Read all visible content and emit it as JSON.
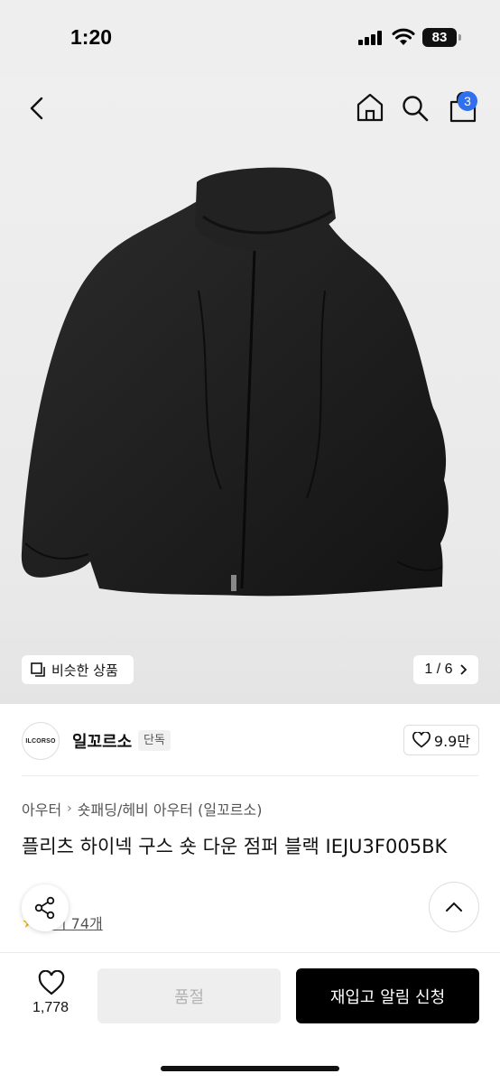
{
  "status_bar": {
    "time": "1:20",
    "battery": "83"
  },
  "header": {
    "cart_count": "3"
  },
  "gallery": {
    "similar_label": "비슷한 상품",
    "pager": "1 / 6"
  },
  "brand": {
    "logo_text": "ILCORSO",
    "name": "일꼬르소",
    "tag": "단독",
    "likes": "9.9만"
  },
  "product": {
    "breadcrumb": [
      "아우터",
      "숏패딩/헤비 아우터 (일꼬르소)"
    ],
    "title": "플리츠 하이넥 구스 숏 다운 점퍼 블랙 IEJU3F005BK",
    "review_text": "후기 74개"
  },
  "bottom_bar": {
    "wish_count": "1,778",
    "soldout_label": "품절",
    "restock_label": "재입고 알림 신청"
  },
  "colors": {
    "accent": "#2f6ff0",
    "primary_button": "#000000",
    "disabled_button": "#eeeeee",
    "star": "#f5b800"
  },
  "icons": [
    "back-icon",
    "home-icon",
    "search-icon",
    "cart-icon",
    "similar-icon",
    "chevron-right-icon",
    "heart-icon",
    "share-icon",
    "chevron-up-icon",
    "star-icon"
  ]
}
